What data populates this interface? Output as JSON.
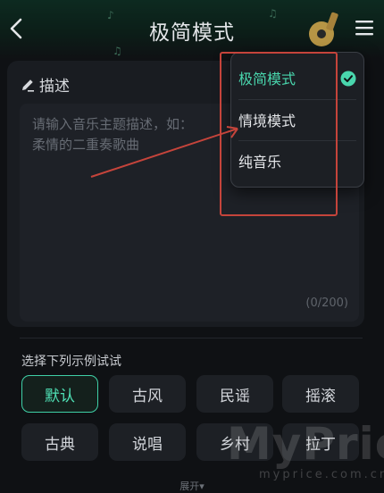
{
  "header": {
    "title": "极简模式"
  },
  "description": {
    "label": "描述",
    "placeholder": "请输入音乐主题描述，如：\n柔情的二重奏歌曲",
    "counter": "(0/200)"
  },
  "examples": {
    "label": "选择下列示例试试",
    "chips": [
      {
        "label": "默认",
        "active": true
      },
      {
        "label": "古风",
        "active": false
      },
      {
        "label": "民谣",
        "active": false
      },
      {
        "label": "摇滚",
        "active": false
      },
      {
        "label": "古典",
        "active": false
      },
      {
        "label": "说唱",
        "active": false
      },
      {
        "label": "乡村",
        "active": false
      },
      {
        "label": "拉丁",
        "active": false
      }
    ],
    "expand_hint": "展开▾"
  },
  "mode_menu": {
    "items": [
      {
        "label": "极简模式",
        "selected": true
      },
      {
        "label": "情境模式",
        "selected": false
      },
      {
        "label": "纯音乐",
        "selected": false
      }
    ]
  },
  "watermark": {
    "brand": "MyPrice",
    "url": "myprice.com.cn"
  },
  "colors": {
    "accent": "#49d6ad",
    "annotation": "#c5443b",
    "background": "#0f1114"
  }
}
